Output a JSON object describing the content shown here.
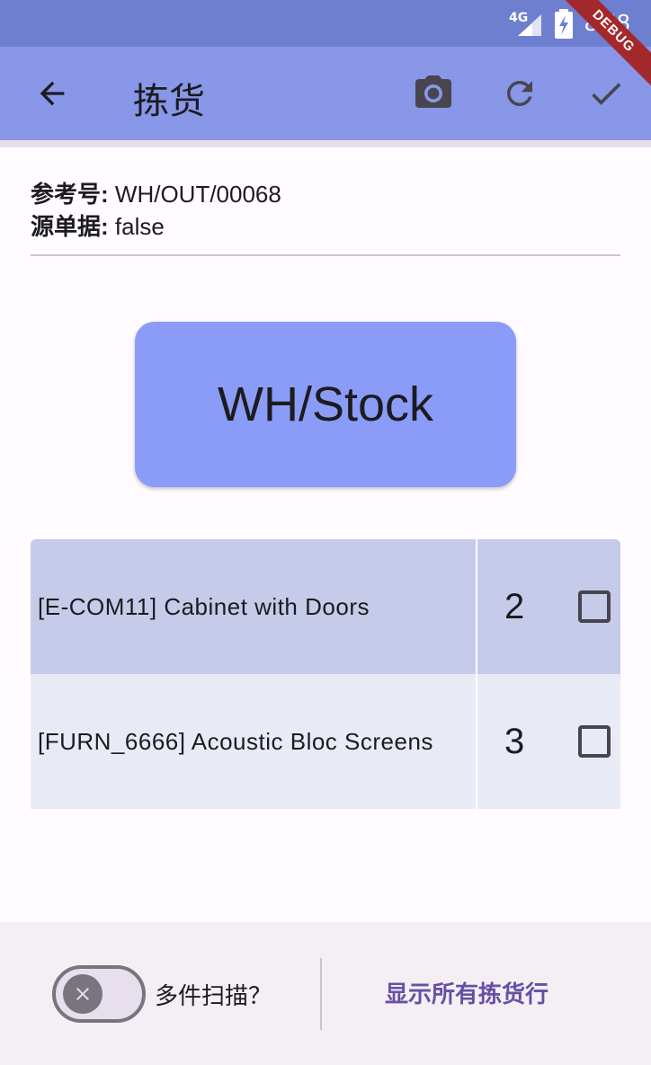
{
  "status_bar": {
    "network": "4G",
    "time": "8:48"
  },
  "debug_banner": "DEBUG",
  "app_bar": {
    "title": "拣货",
    "icons": [
      "back-arrow-icon",
      "camera-icon",
      "refresh-icon",
      "check-icon"
    ]
  },
  "info": {
    "ref_label": "参考号:",
    "ref_value": "WH/OUT/00068",
    "source_label": "源单据:",
    "source_value": "false"
  },
  "location_button": {
    "label": "WH/Stock"
  },
  "lines": [
    {
      "product": "[E-COM11] Cabinet with Doors",
      "qty": "2",
      "checked": false
    },
    {
      "product": "[FURN_6666] Acoustic Bloc Screens",
      "qty": "3",
      "checked": false
    }
  ],
  "bottom": {
    "multi_scan_label": "多件扫描？",
    "multi_scan_on": false,
    "show_all_label": "显示所有拣货行"
  },
  "colors": {
    "status_bar": "#6f7fd0",
    "app_bar": "#8897e8",
    "location_button": "#8a9cf7",
    "row_highlight": "#c5cbe8",
    "row_normal": "#e8ebf5",
    "accent_text": "#6750a4"
  }
}
